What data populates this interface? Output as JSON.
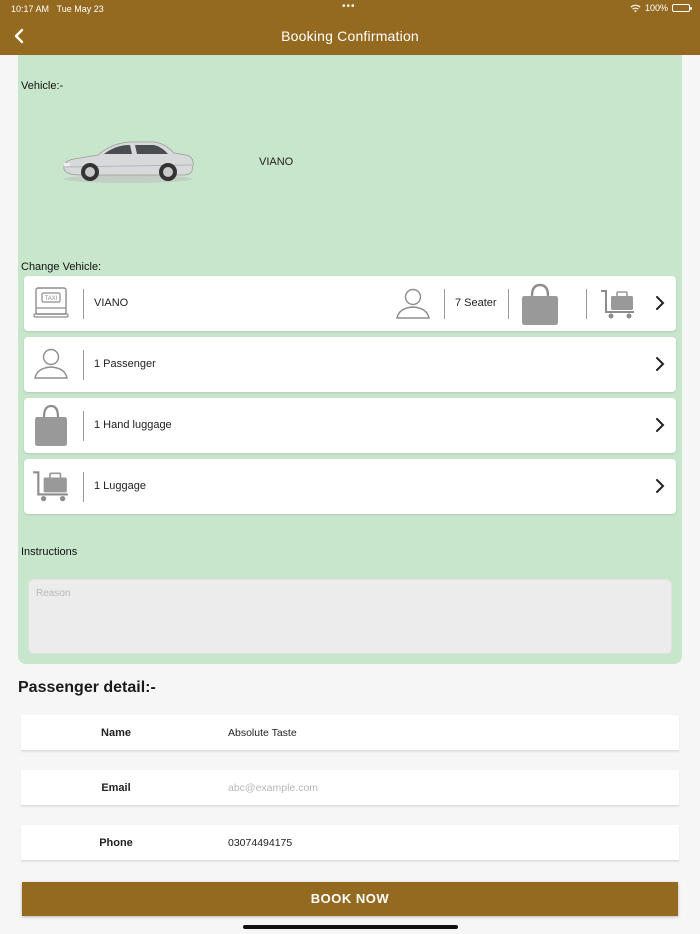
{
  "status": {
    "time": "10:17 AM",
    "date": "Tue May 23",
    "dots": "•••",
    "battery": "100%"
  },
  "nav": {
    "title": "Booking Confirmation",
    "back_icon": "chevron-left-icon"
  },
  "vehicle": {
    "label": "Vehicle:-",
    "name": "VIANO"
  },
  "change_vehicle": {
    "label": "Change Vehicle:",
    "rows": [
      {
        "text": "VIANO",
        "icon": "taxi-icon",
        "seater": "7 Seater"
      },
      {
        "text": "1 Passenger",
        "icon": "person-icon"
      },
      {
        "text": "1 Hand luggage",
        "icon": "handbag-icon"
      },
      {
        "text": "1 Luggage",
        "icon": "luggage-cart-icon"
      }
    ]
  },
  "instructions": {
    "label": "Instructions",
    "placeholder": "Reason"
  },
  "passenger": {
    "title": "Passenger detail:-",
    "fields": [
      {
        "key": "Name",
        "value": "Absolute Taste",
        "placeholder": ""
      },
      {
        "key": "Email",
        "value": "",
        "placeholder": "abc@example.com"
      },
      {
        "key": "Phone",
        "value": "03074494175",
        "placeholder": ""
      }
    ]
  },
  "book_button": "BOOK NOW",
  "colors": {
    "brand": "#946a20",
    "panel": "#c8e6cb"
  }
}
